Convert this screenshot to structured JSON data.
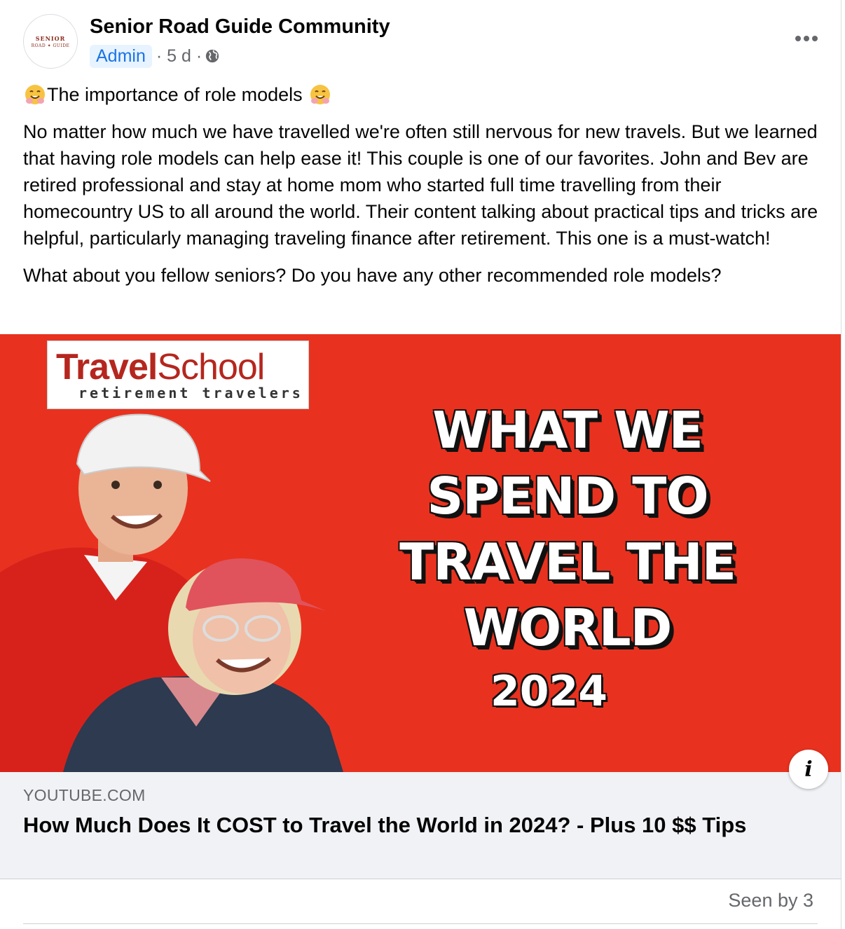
{
  "post": {
    "page_name": "Senior Road Guide Community",
    "avatar_line1": "SENIOR",
    "avatar_line2": "ROAD ✦ GUIDE",
    "admin_badge": "Admin",
    "time": "· 5 d ·",
    "more_icon": "more-horizontal-icon",
    "title": "The importance of role models",
    "body_paragraph_1": "No matter how much we have travelled we're often still nervous for new travels. But we learned that having role models can help ease it! This couple is one of our favorites. John and Bev are retired professional and stay at home mom who started full time travelling from their homecountry US to all around the world. Their content talking about practical tips and tricks are helpful, particularly managing traveling finance after retirement. This one is a must-watch!",
    "body_paragraph_2": "What about you fellow seniors? Do you have any other recommended role models?"
  },
  "thumbnail": {
    "logo_part1": "Travel",
    "logo_part2": "School",
    "logo_sub": "retirement travelers",
    "headline_line1": "WHAT WE",
    "headline_line2": "SPEND TO",
    "headline_line3": "TRAVEL THE",
    "headline_line4": "WORLD",
    "year": "2024",
    "background_color": "#e8321f"
  },
  "link": {
    "domain": "YOUTUBE.COM",
    "title": "How Much Does It COST to Travel the World in 2024? - Plus 10 $$ Tips",
    "info_label": "i"
  },
  "footer": {
    "seen_by": "Seen by 3"
  }
}
